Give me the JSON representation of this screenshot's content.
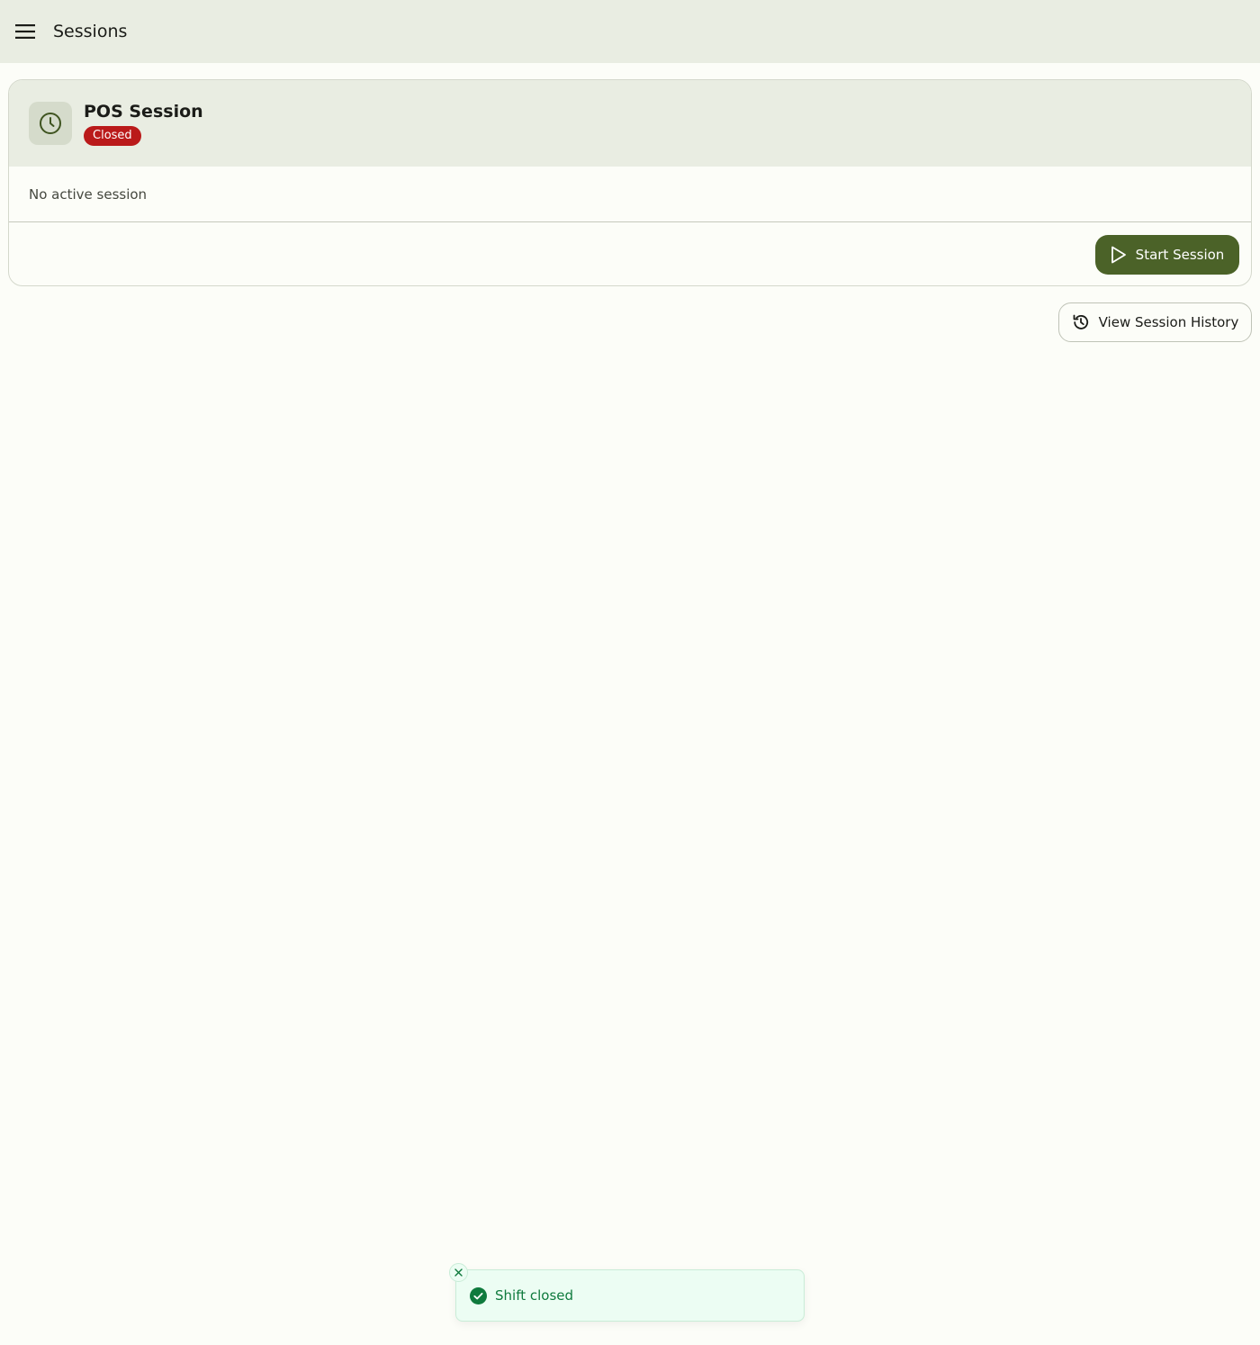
{
  "app_bar": {
    "title": "Sessions",
    "menu_icon": "hamburger-menu-icon"
  },
  "session_card": {
    "icon": "clock-icon",
    "title": "POS Session",
    "status": "Closed",
    "body_text": "No active session",
    "start_button_label": "Start Session",
    "start_button_icon": "play-icon"
  },
  "history_button": {
    "label": "View Session History",
    "icon": "history-icon"
  },
  "toast": {
    "message": "Shift closed",
    "icon": "check-circle-icon",
    "close_icon": "close-icon"
  },
  "colors": {
    "app_bar_bg": "#e9ede2",
    "primary": "#4b6228",
    "status_closed": "#ba1a1a",
    "toast_success": "#0f7a3d"
  }
}
